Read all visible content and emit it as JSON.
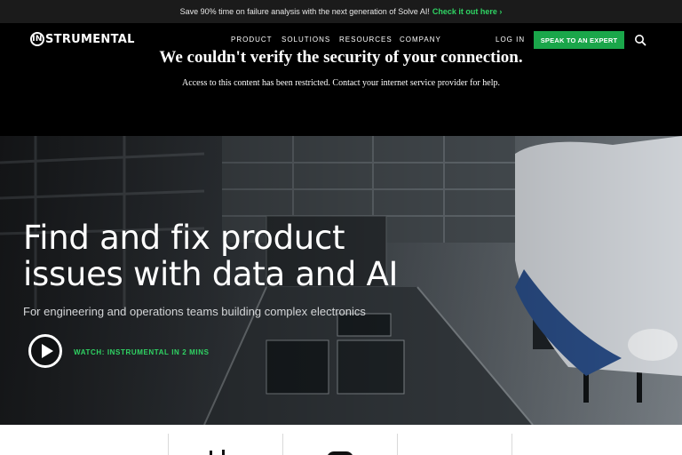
{
  "announcement": {
    "text": "Save 90% time on failure analysis with the next generation of Solve AI!",
    "cta": "Check it out here ›"
  },
  "nav": {
    "logo_mark": "IN",
    "logo_rest": "STRUMENTAL",
    "items": [
      "PRODUCT",
      "SOLUTIONS",
      "RESOURCES",
      "COMPANY"
    ],
    "login": "LOG IN",
    "expert_button": "SPEAK TO AN EXPERT",
    "search_icon": "search-icon"
  },
  "security_notice": {
    "title": "We couldn't verify the security of your connection.",
    "message": "Access to this content has been restricted. Contact your internet service provider for help."
  },
  "hero": {
    "title": "Find and fix product issues with data and AI",
    "subtitle": "For engineering and operations teams building complex electronics",
    "video_label": "WATCH: INSTRUMENTAL IN 2 MINS",
    "play_icon": "play-icon"
  },
  "colors": {
    "accent_green": "#1aa64a",
    "cta_green": "#2fd363",
    "announcement_bg": "#1b1b1b",
    "nav_bg": "#000000"
  }
}
